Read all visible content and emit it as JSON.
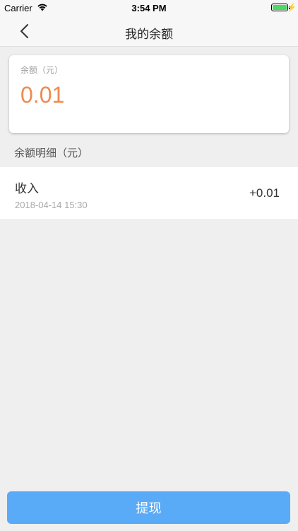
{
  "status_bar": {
    "carrier": "Carrier",
    "time": "3:54 PM",
    "icons": [
      "wifi-icon",
      "battery-icon",
      "charging-bolt-icon"
    ],
    "battery_color": "#4cd964"
  },
  "nav": {
    "title": "我的余额",
    "back_icon": "chevron-left-icon"
  },
  "balance_card": {
    "label": "余额（元）",
    "amount": "0.01",
    "amount_color": "#ee8a52"
  },
  "details": {
    "title": "余额明细（元）",
    "items": [
      {
        "type": "收入",
        "time": "2018-04-14 15:30",
        "amount": "+0.01"
      }
    ]
  },
  "withdraw_button": {
    "label": "提现",
    "color": "#5aabf7"
  }
}
